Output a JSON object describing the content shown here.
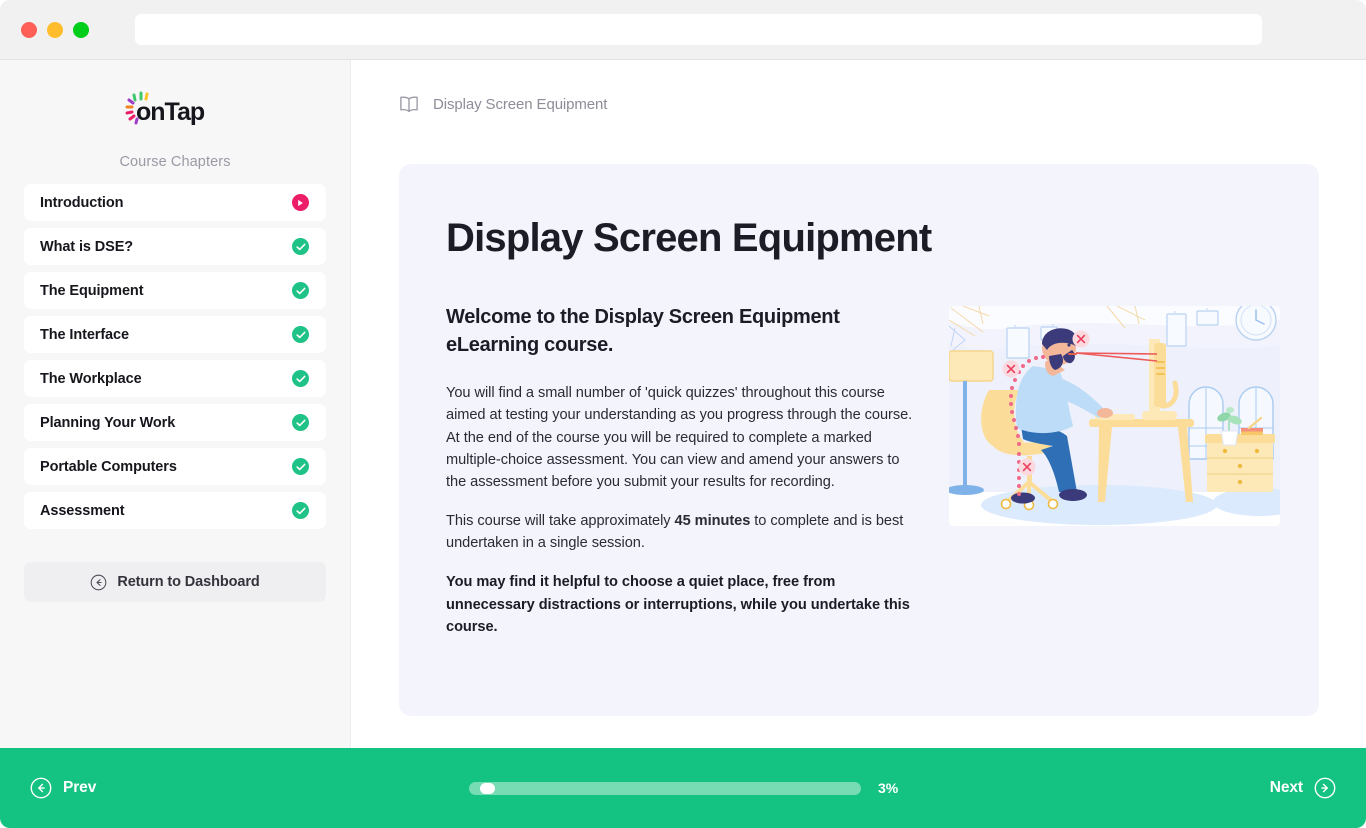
{
  "browser": {
    "traffic_lights": [
      "close",
      "minimize",
      "maximize"
    ],
    "url_value": "",
    "url_placeholder": ""
  },
  "sidebar": {
    "logo_text": "onTap",
    "logo_dot_colors": [
      "#3fc76a",
      "#f7c325",
      "#f58220",
      "#ed1e68",
      "#a03ec6",
      "#1fc287"
    ],
    "chapters_label": "Course Chapters",
    "items": [
      {
        "label": "Introduction",
        "status": "active"
      },
      {
        "label": "What is DSE?",
        "status": "done"
      },
      {
        "label": "The Equipment",
        "status": "done"
      },
      {
        "label": "The Interface",
        "status": "done"
      },
      {
        "label": "The Workplace",
        "status": "done"
      },
      {
        "label": "Planning Your Work",
        "status": "done"
      },
      {
        "label": "Portable Computers",
        "status": "done"
      },
      {
        "label": "Assessment",
        "status": "done"
      }
    ],
    "return_button": "Return to Dashboard"
  },
  "main": {
    "breadcrumb": "Display Screen Equipment",
    "card_title": "Display Screen Equipment",
    "lead": "Welcome to the Display Screen Equipment eLearning course.",
    "paragraph_1": "You will find a small number of 'quick quizzes' throughout this course aimed at testing your understanding as you progress through the course.  At the end of the course you will be required to complete a marked multiple-choice assessment. You can view and amend your answers to the assessment before you submit your results for recording.",
    "paragraph_2_before": "This course will take approximately ",
    "paragraph_2_bold": "45 minutes",
    "paragraph_2_after": " to complete and is best undertaken in a single session.",
    "paragraph_3": "You may find it helpful to choose a quiet place, free from unnecessary distractions or interruptions, while you undertake this course.",
    "illustration_alt": "person-sitting-with-poor-posture-at-desk-illustration"
  },
  "footer": {
    "prev_label": "Prev",
    "next_label": "Next",
    "progress_percent_label": "3%",
    "progress_percent_value": 3
  },
  "colors": {
    "brand_green": "#14c282",
    "status_done": "#1fc287",
    "status_active": "#ed1e68",
    "card_background": "#f4f4fc",
    "sidebar_background": "#f7f7f8"
  }
}
